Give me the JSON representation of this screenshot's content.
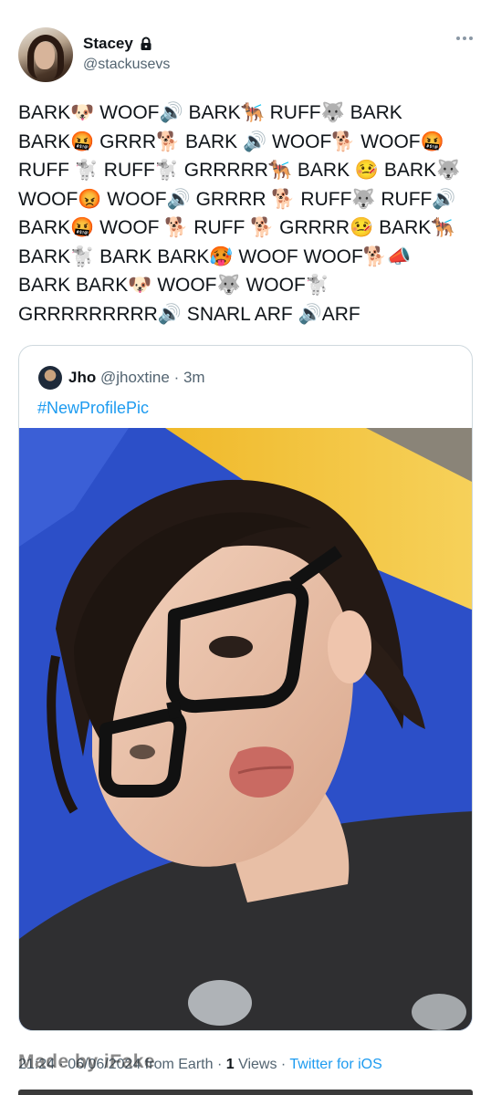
{
  "tweet": {
    "author_name": "Stacey",
    "author_handle": "@stackusevs",
    "text": "BARK🐶 WOOF🔊 BARK🐕‍🦺 RUFF🐺 BARK\nBARK🤬 GRRR🐕 BARK 🔊 WOOF🐕 WOOF🤬\nRUFF 🐩 RUFF🐩 GRRRRR🐕‍🦺 BARK 🤒 BARK🐺\nWOOF😡 WOOF🔊 GRRRR 🐕 RUFF🐺 RUFF🔊\nBARK🤬 WOOF 🐕 RUFF 🐕 GRRRR🤒 BARK🐕‍🦺\nBARK🐩 BARK BARK🥵 WOOF WOOF🐕📣\nBARK BARK🐶 WOOF🐺 WOOF🐩\nGRRRRRRRRR🔊 SNARL ARF 🔊ARF"
  },
  "quoted": {
    "name": "Jho",
    "handle": "@jhoxtine",
    "time": "3m",
    "hashtag": "#NewProfilePic"
  },
  "footer": {
    "time": "21:24 · 06/06/2024",
    "source": "from Earth",
    "views_count": "1",
    "views_label": "Views",
    "client": "Twitter for iOS",
    "watermark": "Made by iFake"
  },
  "colors": {
    "link": "#1d9bf0",
    "secondary_text": "#536471",
    "photo_background_blue": "#2c4fc8",
    "photo_background_yellow": "#f2c230"
  },
  "icons": [
    "lock-icon",
    "more-options-icon"
  ]
}
